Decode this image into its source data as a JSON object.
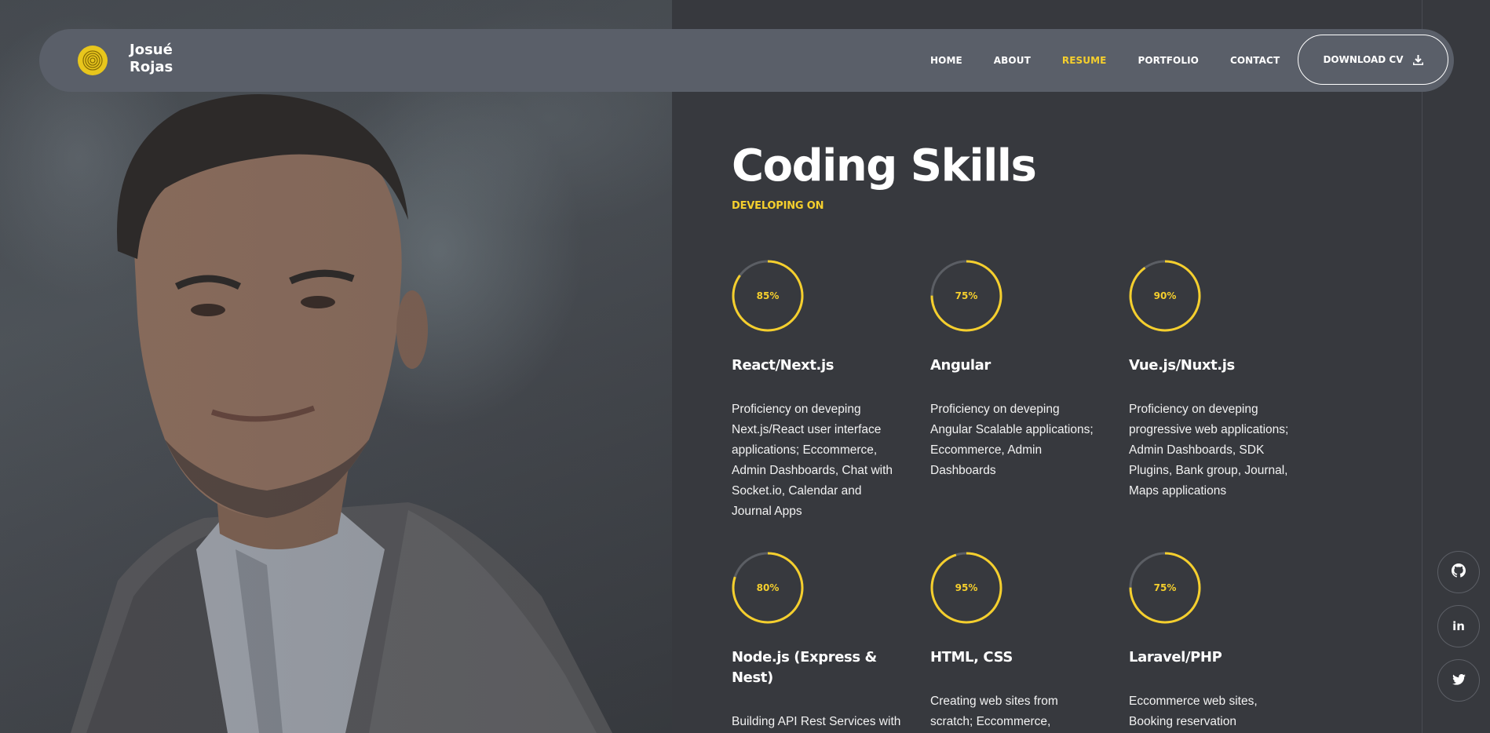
{
  "brand": {
    "name": "Josué Rojas",
    "logo_icon": "fingerprint-icon",
    "accent": "#f5cf2d"
  },
  "nav": {
    "items": [
      {
        "label": "HOME",
        "active": false
      },
      {
        "label": "ABOUT",
        "active": false
      },
      {
        "label": "RESUME",
        "active": true
      },
      {
        "label": "PORTFOLIO",
        "active": false
      },
      {
        "label": "CONTACT",
        "active": false
      }
    ],
    "download_label": "DOWNLOAD CV",
    "download_icon": "download-icon"
  },
  "section": {
    "title": "Coding Skills",
    "subtitle": "DEVELOPING ON"
  },
  "skills": [
    {
      "percent": "85%",
      "value": 0.85,
      "name": "React/Next.js",
      "description": "Proficiency on deveping Next.js/React user interface applications; Eccommerce, Admin Dashboards, Chat with Socket.io, Calendar and Journal Apps"
    },
    {
      "percent": "75%",
      "value": 0.75,
      "name": "Angular",
      "description": "Proficiency on deveping Angular Scalable applications; Eccommerce, Admin Dashboards"
    },
    {
      "percent": "90%",
      "value": 0.9,
      "name": "Vue.js/Nuxt.js",
      "description": "Proficiency on deveping progressive web applications; Admin Dashboards, SDK Plugins, Bank group, Journal, Maps applications"
    },
    {
      "percent": "80%",
      "value": 0.8,
      "name": "Node.js (Express & Nest)",
      "description": "Building API Rest Services with"
    },
    {
      "percent": "95%",
      "value": 0.95,
      "name": "HTML, CSS",
      "description": "Creating web sites from scratch; Eccommerce,"
    },
    {
      "percent": "75%",
      "value": 0.75,
      "name": "Laravel/PHP",
      "description": "Eccommerce web sites, Booking reservation"
    }
  ],
  "social": [
    {
      "icon": "github-icon"
    },
    {
      "icon": "linkedin-icon"
    },
    {
      "icon": "twitter-icon"
    }
  ],
  "colors": {
    "background": "#37393e",
    "navbar": "#5a5f69",
    "ring_track": "#5b5e64",
    "ring_fill": "#f5cf2d"
  }
}
